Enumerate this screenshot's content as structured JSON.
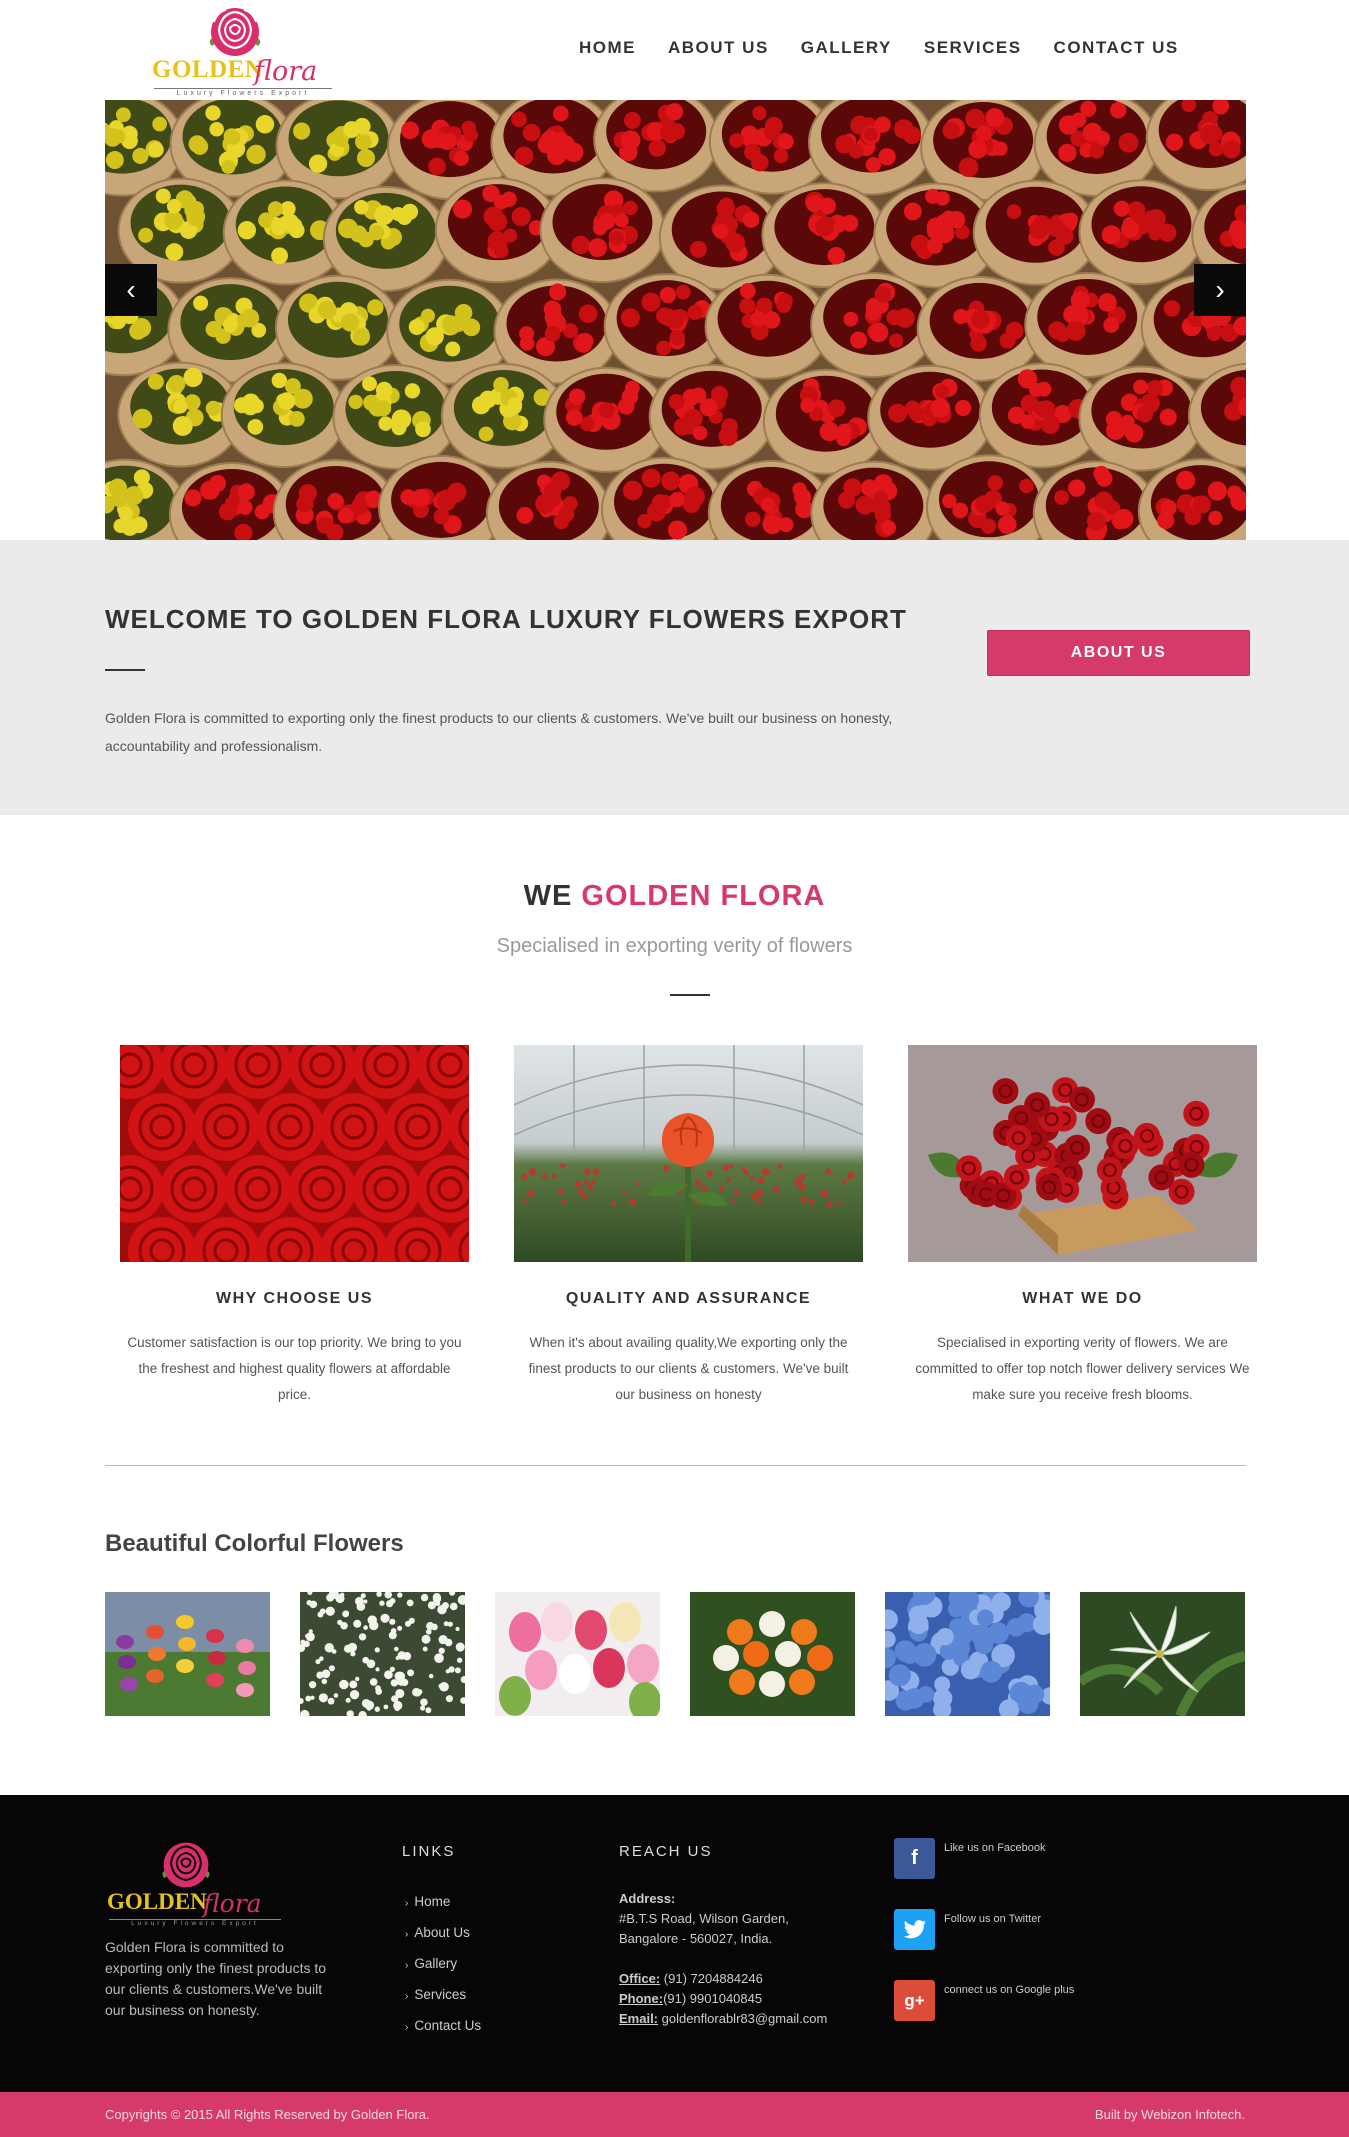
{
  "brand": {
    "name": "GOLDEN",
    "script": "flora",
    "tagline": "Luxury Flowers Export"
  },
  "nav": {
    "items": [
      "HOME",
      "ABOUT US",
      "GALLERY",
      "SERVICES",
      "CONTACT US"
    ]
  },
  "hero": {
    "prev_icon": "chevron-left-icon",
    "next_icon": "chevron-right-icon"
  },
  "welcome": {
    "title": "WELCOME TO GOLDEN FLORA LUXURY FLOWERS EXPORT",
    "text": "Golden Flora is committed to exporting only the finest products to our clients & customers. We've built our business on honesty, accountability and professionalism.",
    "button": "ABOUT US"
  },
  "intro": {
    "title_prefix": "WE",
    "title_accent": "GOLDEN FLORA",
    "subtitle": "Specialised in exporting verity of flowers"
  },
  "features": [
    {
      "title": "WHY CHOOSE US",
      "text": "Customer satisfaction is our top priority. We bring to you the freshest and highest quality flowers at affordable price."
    },
    {
      "title": "QUALITY AND ASSURANCE",
      "text": "When it's about availing quality,We exporting only the finest products to our clients & customers. We've built our business on honesty"
    },
    {
      "title": "WHAT WE DO",
      "text": "Specialised in exporting verity of flowers. We are committed to offer top notch flower delivery services We make sure you receive fresh blooms."
    }
  ],
  "gallery": {
    "title": "Beautiful Colorful Flowers"
  },
  "footer": {
    "about": "Golden Flora is committed to exporting only the finest products to our clients & customers.We've built our business on honesty.",
    "links_title": "LINKS",
    "links": [
      "Home",
      "About Us",
      "Gallery",
      "Services",
      "Contact Us"
    ],
    "reach_title": "REACH US",
    "address_label": "Address:",
    "address_line1": "#B.T.S Road, Wilson Garden,",
    "address_line2": "Bangalore - 560027, India.",
    "office_label": "Office:",
    "office_value": " (91) 7204884246",
    "phone_label": "Phone:",
    "phone_value": "(91) 9901040845",
    "email_label": "Email:",
    "email_value": " goldenflorablr83@gmail.com",
    "social": [
      {
        "icon": "facebook-icon",
        "glyph": "f",
        "text": "Like us on Facebook",
        "color": "#3b5998"
      },
      {
        "icon": "twitter-icon",
        "glyph": "t",
        "text": "Follow us on Twitter",
        "color": "#1da1f2"
      },
      {
        "icon": "google-plus-icon",
        "glyph": "g+",
        "text": "connect us on Google plus",
        "color": "#dd4b39"
      }
    ]
  },
  "copyright": {
    "left": "Copyrights © 2015 All Rights Reserved by Golden Flora.",
    "right": "Built by Webizon Infotech."
  },
  "colors": {
    "accent": "#d63a68",
    "dark": "#060606",
    "band": "#ebebeb"
  }
}
